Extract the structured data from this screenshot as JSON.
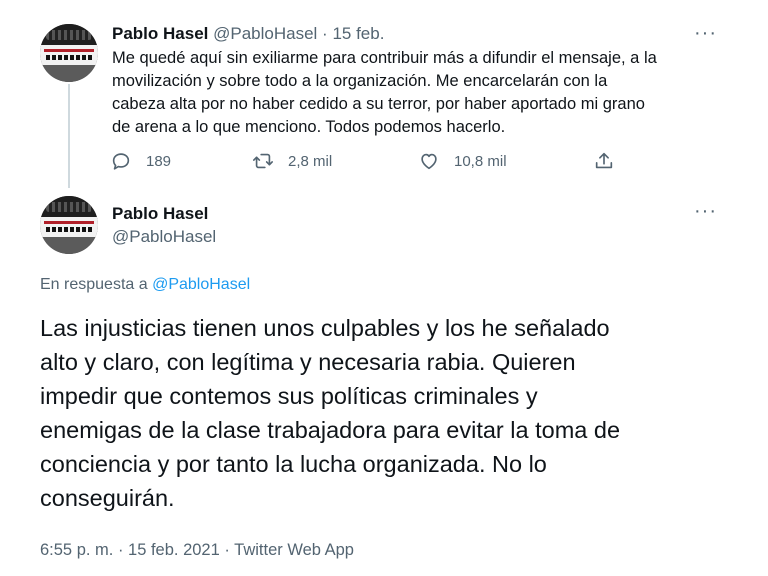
{
  "tweet1": {
    "display_name": "Pablo Hasel",
    "handle": "@PabloHasel",
    "separator": "·",
    "date": "15 feb.",
    "more": "···",
    "text_lines": [
      "Me quedé aquí sin exiliarme para contribuir más a difundir el mensaje, a la",
      "movilización y sobre todo a la organización. Me encarcelarán con la",
      "cabeza alta por no haber cedido a su terror, por haber aportado mi grano",
      "de arena a lo que menciono. Todos podemos hacerlo."
    ],
    "actions": {
      "replies": "189",
      "retweets": "2,8 mil",
      "likes": "10,8 mil"
    },
    "icons": [
      "reply-icon",
      "retweet-icon",
      "like-icon",
      "share-icon"
    ]
  },
  "tweet2": {
    "display_name": "Pablo Hasel",
    "handle": "@PabloHasel",
    "more": "···",
    "reply_prefix": "En respuesta a ",
    "reply_handle": "@PabloHasel",
    "text_lines": [
      "Las injusticias tienen unos culpables y los he señalado",
      "alto y claro, con legítima y necesaria rabia. Quieren",
      "impedir que contemos sus políticas criminales y",
      "enemigas de la clase trabajadora para evitar la toma de",
      "conciencia y por tanto la lucha organizada. No lo",
      "conseguirán."
    ],
    "timestamp": "6:55 p. m. · 15 feb. 2021 · Twitter Web App"
  },
  "colors": {
    "text": "#0f1419",
    "muted": "#536471",
    "link": "#1d9bf0",
    "thread_line": "#cfd9de"
  }
}
